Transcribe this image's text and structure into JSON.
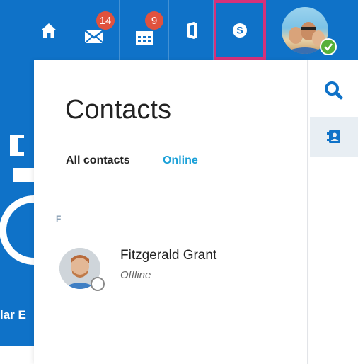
{
  "topbar": {
    "mail_badge": "14",
    "calendar_badge": "9"
  },
  "background": {
    "partial_text": "lar E"
  },
  "contacts": {
    "title": "Contacts",
    "tabs": [
      {
        "label": "All contacts",
        "active": true
      },
      {
        "label": "Online",
        "active": false
      }
    ],
    "groups": [
      {
        "letter": "F",
        "items": [
          {
            "name": "Fitzgerald Grant",
            "status": "Offline"
          }
        ]
      }
    ]
  },
  "colors": {
    "brand_blue": "#0f72c8",
    "badge_red": "#e0523e",
    "highlight_pink": "#d6317a",
    "online_tab": "#1aa0d8",
    "presence_online": "#57b03a"
  },
  "icons": [
    "home-icon",
    "mail-icon",
    "calendar-icon",
    "office-icon",
    "skype-icon",
    "search-icon",
    "contacts-book-icon",
    "check-icon"
  ]
}
